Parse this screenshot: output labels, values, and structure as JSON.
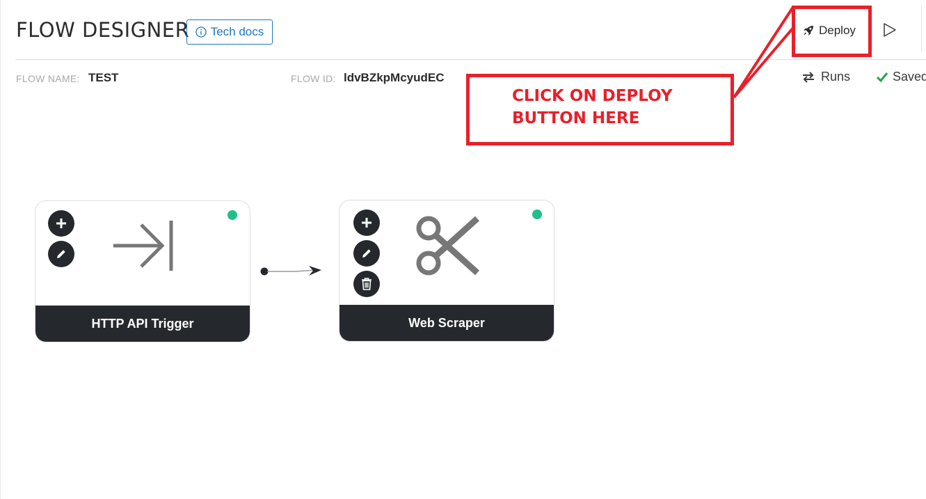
{
  "header": {
    "title": "FLOW DESIGNER",
    "tech_docs_label": "Tech docs",
    "deploy_label": "Deploy"
  },
  "meta": {
    "flow_name_label": "FLOW NAME:",
    "flow_name_value": "TEST",
    "flow_id_label": "FLOW ID:",
    "flow_id_value": "ldvBZkpMcyudEC",
    "runs_label": "Runs",
    "saved_label": "Saved"
  },
  "annotation": {
    "text": "CLICK ON DEPLOY\nBUTTON HERE",
    "color": "#e8202a"
  },
  "nodes": [
    {
      "label": "HTTP API Trigger",
      "icon": "arrow-to-line-icon",
      "status": "active",
      "status_color": "#20c08a",
      "actions": [
        "add",
        "edit"
      ]
    },
    {
      "label": "Web Scraper",
      "icon": "scissors-icon",
      "status": "active",
      "status_color": "#20c08a",
      "actions": [
        "add",
        "edit",
        "delete"
      ]
    }
  ],
  "colors": {
    "accent": "#1b75c4",
    "node_dark": "#25282c",
    "status_green": "#20c08a",
    "saved_check": "#1fa64a"
  }
}
